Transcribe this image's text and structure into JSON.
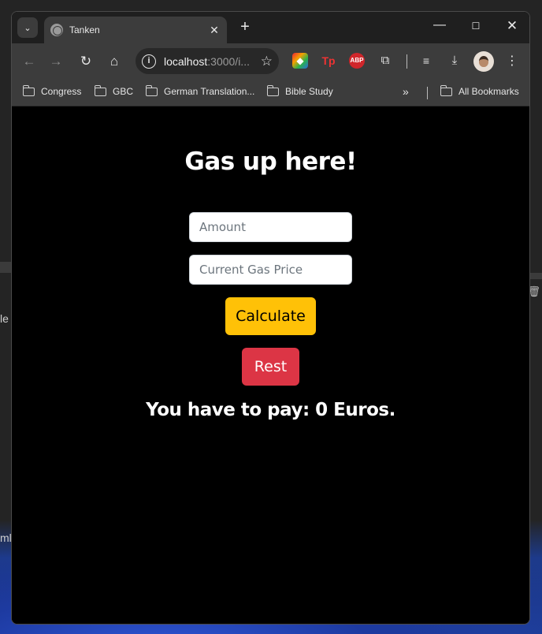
{
  "browser": {
    "tab_title": "Tanken",
    "url_host": "localhost",
    "url_rest": ":3000/i...",
    "bookmarks": [
      "Congress",
      "GBC",
      "German Translation...",
      "Bible Study"
    ],
    "all_bookmarks": "All Bookmarks",
    "extensions": {
      "tp": "Tp",
      "abp": "ABP"
    }
  },
  "desktop": {
    "text_a": "le",
    "text_b": "ml"
  },
  "page": {
    "heading": "Gas up here!",
    "amount_placeholder": "Amount",
    "price_placeholder": "Current Gas Price",
    "calculate_label": "Calculate",
    "reset_label": "Rest",
    "result_text": "You have to pay: 0 Euros."
  },
  "colors": {
    "calculate": "#ffc107",
    "reset": "#dc3545",
    "page_bg": "#000000"
  }
}
